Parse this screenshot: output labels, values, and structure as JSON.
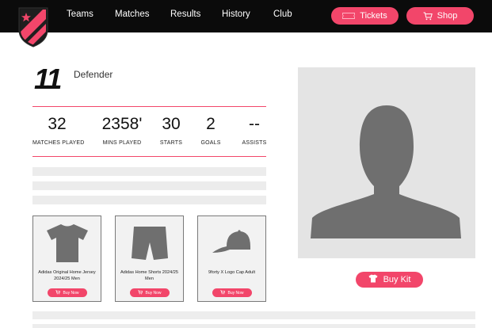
{
  "header": {
    "nav": [
      {
        "label": "Teams"
      },
      {
        "label": "Matches"
      },
      {
        "label": "Results"
      },
      {
        "label": "History"
      },
      {
        "label": "Club"
      }
    ],
    "tickets_label": "Tickets",
    "shop_label": "Shop",
    "icons": {
      "crest": "club-crest-logo",
      "ticket": "ticket-icon",
      "shop": "cart-icon"
    }
  },
  "player": {
    "number": "11",
    "position": "Defender"
  },
  "stats": [
    {
      "value": "32",
      "label": "MATCHES PLAYED"
    },
    {
      "value": "2358'",
      "label": "MINS PLAYED"
    },
    {
      "value": "30",
      "label": "STARTS"
    },
    {
      "value": "2",
      "label": "GOALS"
    },
    {
      "value": "--",
      "label": "ASSISTS"
    }
  ],
  "products": [
    {
      "name": "Adidas Original Home Jersey 2024/25 Men",
      "button": "Buy Now",
      "icon": "jersey-icon"
    },
    {
      "name": "Adidas Home Shorts 2024/25 Men",
      "button": "Buy Now",
      "icon": "shorts-icon"
    },
    {
      "name": "9forty X Logo Cap Adult",
      "button": "Buy Now",
      "icon": "cap-icon"
    }
  ],
  "buy_kit_label": "Buy Kit",
  "colors": {
    "accent": "#f2466a",
    "nav_bg": "#0b0b0b",
    "placeholder": "#ececec",
    "silhouette": "#6f6f6f"
  }
}
